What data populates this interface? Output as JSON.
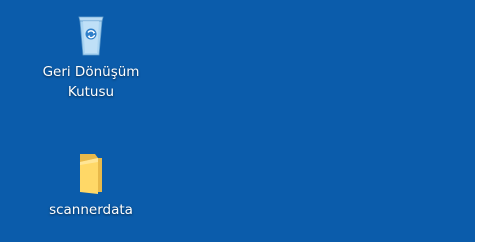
{
  "desktop": {
    "background_color": "#0b5cab",
    "icons": [
      {
        "icon": "recycle-bin-icon",
        "label_line1": "Geri Dönüşüm",
        "label_line2": "Kutusu"
      },
      {
        "icon": "folder-icon",
        "label_line1": "scannerdata"
      }
    ]
  }
}
